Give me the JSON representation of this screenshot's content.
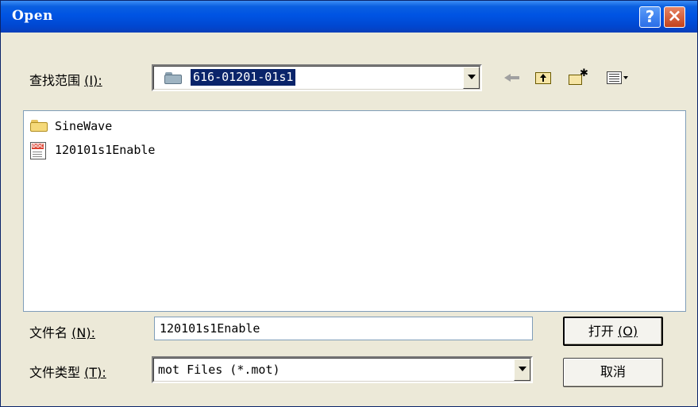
{
  "window": {
    "title": "Open",
    "help_label": "?",
    "close_label": "×"
  },
  "lookin": {
    "label": "查找范围",
    "accel": "(I):",
    "folder": "616-01201-01s1"
  },
  "files": [
    {
      "name": "SineWave",
      "type": "folder-icon"
    },
    {
      "name": "120101s1Enable",
      "type": "doc-icon"
    }
  ],
  "filename": {
    "label": "文件名",
    "accel": "(N):",
    "value": "120101s1Enable"
  },
  "filetype": {
    "label": "文件类型",
    "accel": "(T):",
    "value": "mot Files (*.mot)"
  },
  "buttons": {
    "open": "打开",
    "open_accel": "(O)",
    "cancel": "取消"
  },
  "colors": {
    "titlebar": "#0054e3",
    "selection": "#0a246a",
    "dialog_bg": "#ece9d8"
  }
}
